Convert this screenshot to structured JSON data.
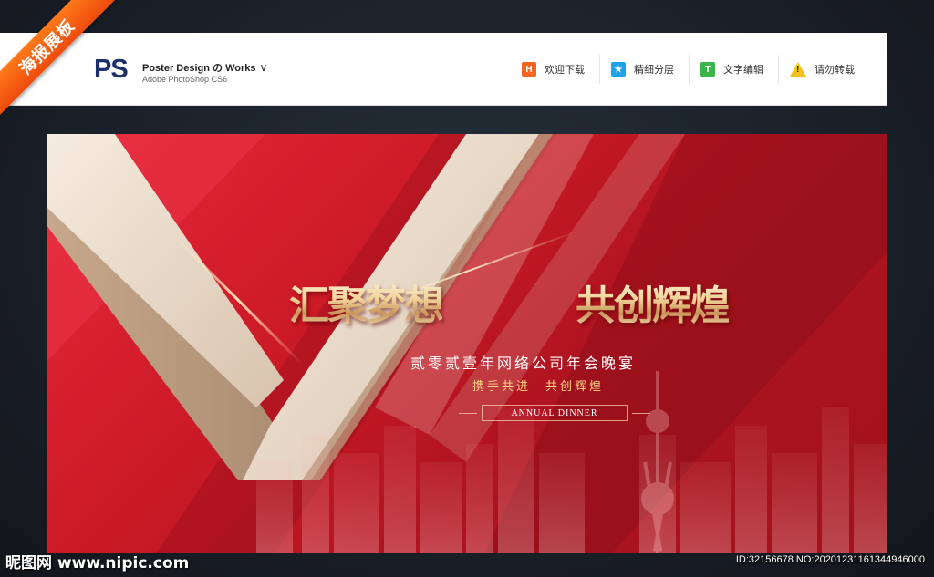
{
  "ribbon": {
    "text": "海报展板"
  },
  "header": {
    "logo": "PS",
    "title": "Poster Design の Works",
    "title_chevron": "∨",
    "subtitle": "Adobe PhotoShop CS6",
    "nav": [
      {
        "label": "欢迎下载",
        "icon": "h-download-icon",
        "icon_glyph": "H",
        "color": "#f26522"
      },
      {
        "label": "精细分层",
        "icon": "star-layers-icon",
        "icon_glyph": "★",
        "color": "#1fa3e8"
      },
      {
        "label": "文字编辑",
        "icon": "t-text-edit-icon",
        "icon_glyph": "T",
        "color": "#39b54a"
      },
      {
        "label": "请勿转载",
        "icon": "warning-icon",
        "icon_glyph": "!",
        "color": "#f1c21b"
      }
    ]
  },
  "poster": {
    "headline_left": "汇聚梦想",
    "headline_right": "共创辉煌",
    "subtitle": "贰零贰壹年网络公司年会晚宴",
    "slogan": "携手共进　共创辉煌",
    "tag": "ANNUAL DINNER",
    "colors": {
      "background": "#cc1a27",
      "accent_gold": "#f1d49a",
      "stripe": "#efe2d2"
    }
  },
  "footer": {
    "logo_text": "昵图网 www.nipic.com",
    "id_text": "ID:32156678 NO:20201231161344946000"
  }
}
